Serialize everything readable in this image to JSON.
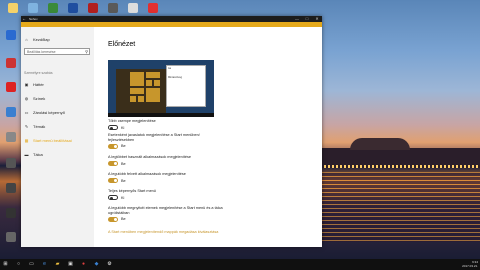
{
  "window": {
    "title": "Néhov",
    "close": "✕",
    "maximize": "□",
    "minimize": "—"
  },
  "sidebar": {
    "home": "Kezdőlap",
    "search_placeholder": "Beállítás keresése",
    "group_label": "Személyre szabás",
    "items": [
      {
        "label": "Háttér",
        "icon": "image-icon"
      },
      {
        "label": "Színek",
        "icon": "palette-icon"
      },
      {
        "label": "Zárolási képernyő",
        "icon": "lock-screen-icon"
      },
      {
        "label": "Témák",
        "icon": "brush-icon"
      },
      {
        "label": "Start menü beállításai",
        "icon": "start-icon"
      },
      {
        "label": "Tálca",
        "icon": "taskbar-icon"
      }
    ]
  },
  "content": {
    "heading": "Előnézet",
    "preview_dialog_line1": "Aa",
    "preview_dialog_line2": "Mintaszöveg",
    "options": [
      {
        "label": "Több csempe megjelenítése",
        "state": "Ki",
        "on": false
      },
      {
        "label": "Esetenként javaslatok megjelenítése a Start menüben/ fejlesztésekben",
        "state": "Be",
        "on": true
      },
      {
        "label": "A legtöbbet használt alkalmazások megjelenítése",
        "state": "Be",
        "on": true
      },
      {
        "label": "A legutóbb felvett alkalmazások megjelenítése",
        "state": "Be",
        "on": true
      },
      {
        "label": "Teljes képernyős Start menü",
        "state": "Ki",
        "on": false
      },
      {
        "label": "A legutóbb megnyitott elemek megjelenítése a Start menü és a tálca ugrólistáiban",
        "state": "Be",
        "on": true
      }
    ],
    "link": "A Start menüben megjelenítendő mappák megadása kiválasztása"
  },
  "taskbar": {
    "time": "9:34",
    "date": "2017.03.21."
  },
  "desktop_icons": [
    {
      "label": "",
      "color": "#f5d26a"
    },
    {
      "label": "",
      "color": "#7fb3e0"
    },
    {
      "label": "",
      "color": "#3a8a3a"
    },
    {
      "label": "",
      "color": "#1f4fa0"
    },
    {
      "label": "",
      "color": "#b02020"
    },
    {
      "label": "",
      "color": "#5a5a5a"
    },
    {
      "label": "",
      "color": "#dddddd"
    },
    {
      "label": "",
      "color": "#e23030"
    }
  ]
}
